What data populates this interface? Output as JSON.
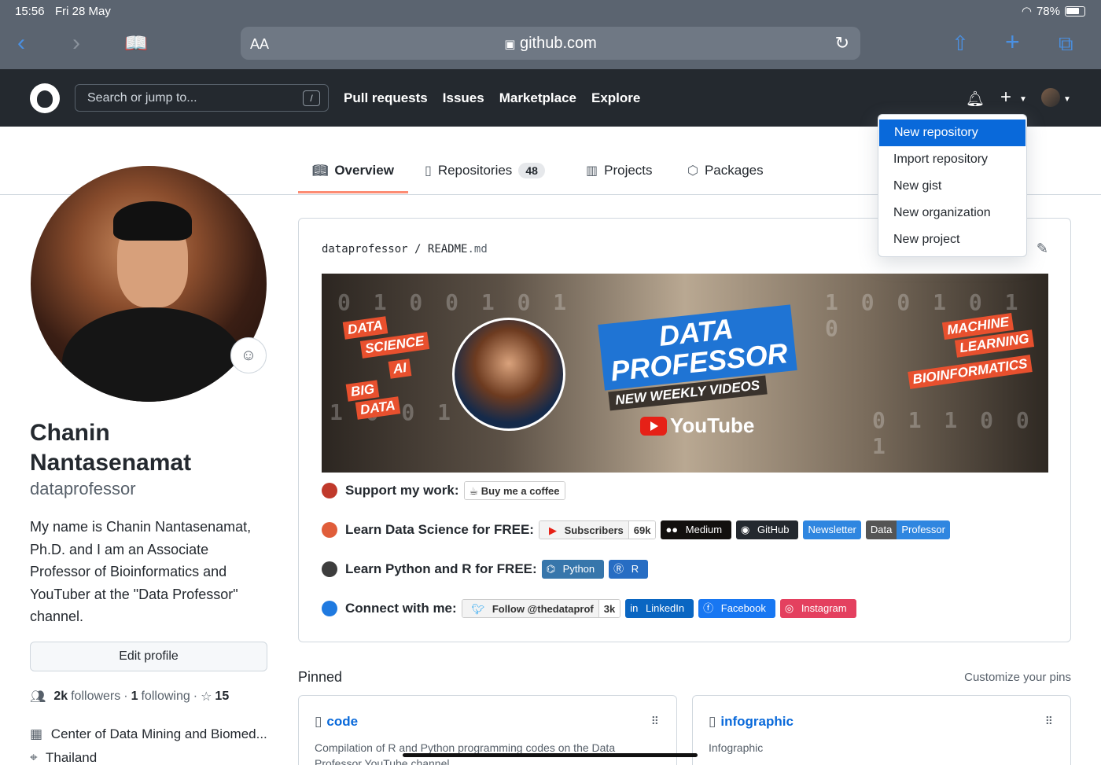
{
  "status": {
    "time": "15:56",
    "date": "Fri 28 May",
    "battery": "78%"
  },
  "browser": {
    "aa": "AA",
    "url": "github.com",
    "lock": "🔒"
  },
  "header": {
    "search_placeholder": "Search or jump to...",
    "slash": "/",
    "nav": [
      "Pull requests",
      "Issues",
      "Marketplace",
      "Explore"
    ]
  },
  "dropdown": [
    "New repository",
    "Import repository",
    "New gist",
    "New organization",
    "New project"
  ],
  "tabs": {
    "overview": "Overview",
    "repositories": "Repositories",
    "repositories_count": "48",
    "projects": "Projects",
    "packages": "Packages"
  },
  "profile": {
    "name": "Chanin Nantasenamat",
    "login": "dataprofessor",
    "bio": "My name is Chanin Nantasenamat, Ph.D. and I am an Associate Professor of Bioinformatics and YouTuber at the \"Data Professor\" channel.",
    "edit": "Edit profile",
    "followers_count": "2k",
    "followers_label": "followers",
    "following_count": "1",
    "following_label": "following",
    "stars": "15",
    "separator": "·",
    "organization": "Center of Data Mining and Biomed...",
    "location": "Thailand"
  },
  "readme": {
    "owner": "dataprofessor",
    "slash": "/",
    "file": "README",
    "ext": ".md",
    "banner": {
      "tags_left": [
        "DATA",
        "SCIENCE",
        "AI",
        "BIG",
        "DATA"
      ],
      "title_1": "DATA",
      "title_2": "PROFESSOR",
      "subtitle": "NEW WEEKLY VIDEOS",
      "yt": "YouTube",
      "tags_right": [
        "MACHINE",
        "LEARNING",
        "BIOINFORMATICS"
      ]
    },
    "lines": [
      {
        "label": "Support my work:",
        "dot": "#c0392b"
      },
      {
        "label": "Learn Data Science for FREE:",
        "dot": "#e05d3a"
      },
      {
        "label": "Learn Python and R for FREE:",
        "dot": "#3d3d3d"
      },
      {
        "label": "Connect with me:",
        "dot": "#1f7ae0"
      }
    ],
    "badges": {
      "coffee": "Buy me a coffee",
      "subscribers": "Subscribers",
      "subscribers_count": "69k",
      "medium": "Medium",
      "github": "GitHub",
      "newsletter": "Newsletter",
      "data": "Data",
      "professor": "Professor",
      "python": "Python",
      "r": "R",
      "twitter": "Follow @thedataprof",
      "twitter_count": "3k",
      "linkedin": "LinkedIn",
      "facebook": "Facebook",
      "instagram": "Instagram"
    }
  },
  "pinned": {
    "title": "Pinned",
    "customize": "Customize your pins",
    "cards": [
      {
        "name": "code",
        "desc": "Compilation of R and Python programming codes on the Data Professor YouTube channel."
      },
      {
        "name": "infographic",
        "desc": "Infographic"
      }
    ]
  }
}
